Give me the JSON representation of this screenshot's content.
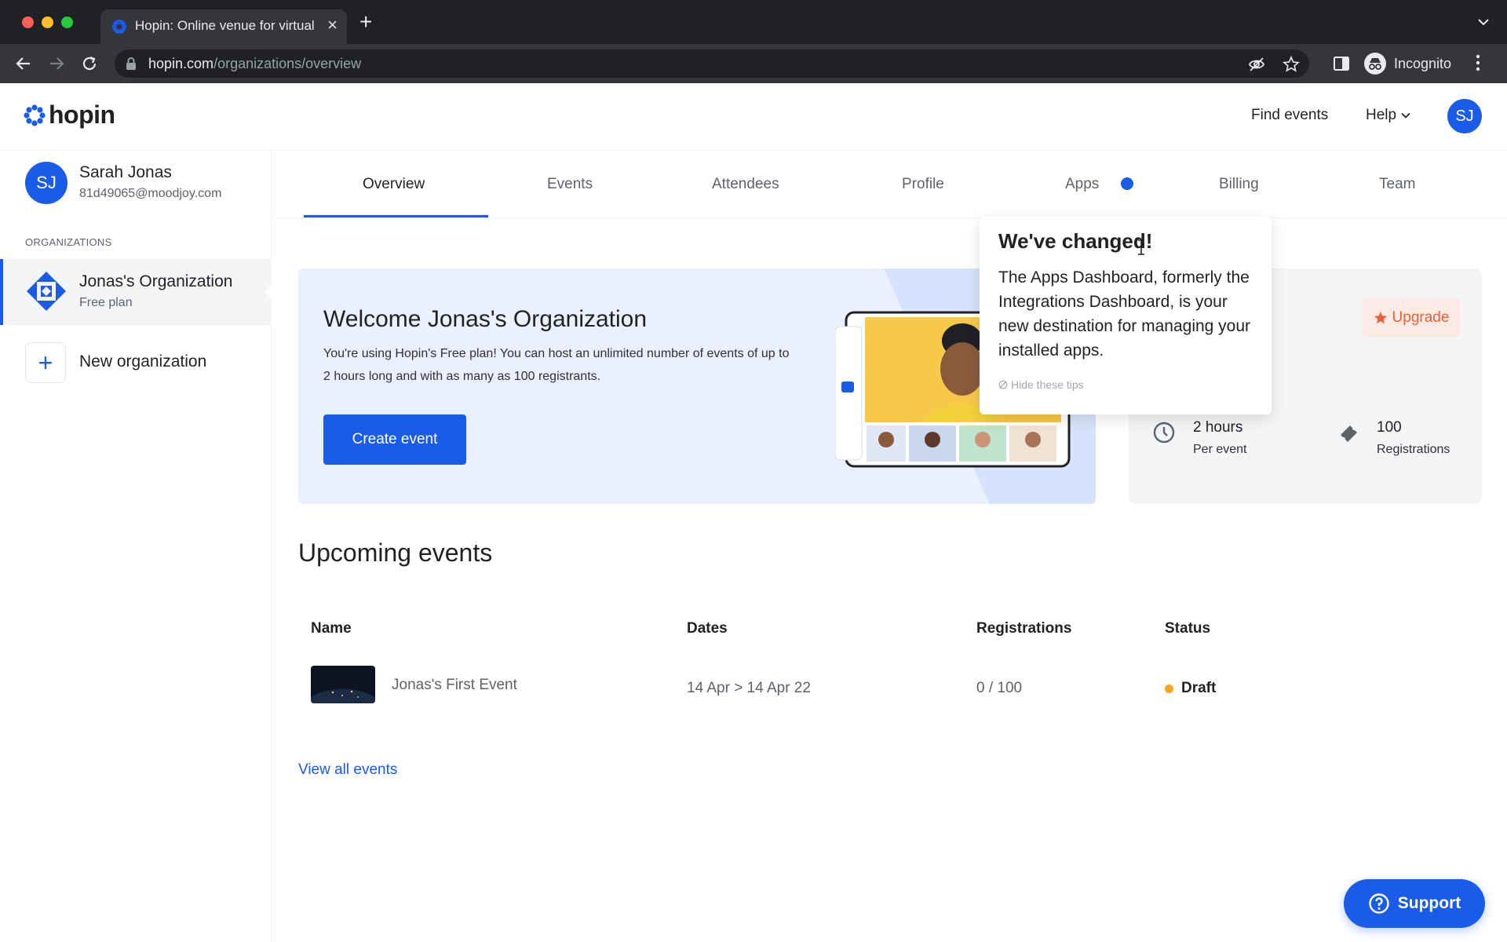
{
  "browser": {
    "tab_title": "Hopin: Online venue for virtual",
    "url_domain": "hopin.com",
    "url_path": "/organizations/overview",
    "profile_label": "Incognito"
  },
  "header": {
    "logo_text": "hopin",
    "find_events": "Find events",
    "help": "Help",
    "avatar_initials": "SJ"
  },
  "sidebar": {
    "user": {
      "initials": "SJ",
      "name": "Sarah Jonas",
      "email": "81d49065@moodjoy.com"
    },
    "section_label": "ORGANIZATIONS",
    "organization": {
      "name": "Jonas's Organization",
      "plan": "Free plan"
    },
    "new_org_label": "New organization"
  },
  "tabs": [
    {
      "label": "Overview",
      "active": true
    },
    {
      "label": "Events"
    },
    {
      "label": "Attendees"
    },
    {
      "label": "Profile"
    },
    {
      "label": "Apps",
      "has_notification_dot": true
    },
    {
      "label": "Billing"
    },
    {
      "label": "Team"
    }
  ],
  "welcome": {
    "title": "Welcome Jonas's Organization",
    "text": "You're using Hopin's Free plan! You can host an unlimited number of events of up to 2 hours long and with as many as 100 registrants.",
    "cta": "Create event"
  },
  "plan": {
    "upgrade_label": "Upgrade",
    "duration_value": "2 hours",
    "duration_label": "Per event",
    "registrations_value": "100",
    "registrations_label": "Registrations"
  },
  "popover": {
    "title": "We've changed!",
    "body": "The Apps Dashboard, formerly the Integrations Dashboard, is your new destination for managing your installed apps.",
    "hide_label": "Hide these tips"
  },
  "upcoming": {
    "title": "Upcoming events",
    "columns": [
      "Name",
      "Dates",
      "Registrations",
      "Status"
    ],
    "rows": [
      {
        "name": "Jonas's First Event",
        "dates": "14 Apr > 14 Apr 22",
        "registrations": "0 / 100",
        "status": "Draft"
      }
    ],
    "view_all": "View all events"
  },
  "support_label": "Support",
  "colors": {
    "brand_blue": "#1a5be8",
    "upgrade_orange": "#e4633b",
    "draft_dot": "#f5a623"
  }
}
